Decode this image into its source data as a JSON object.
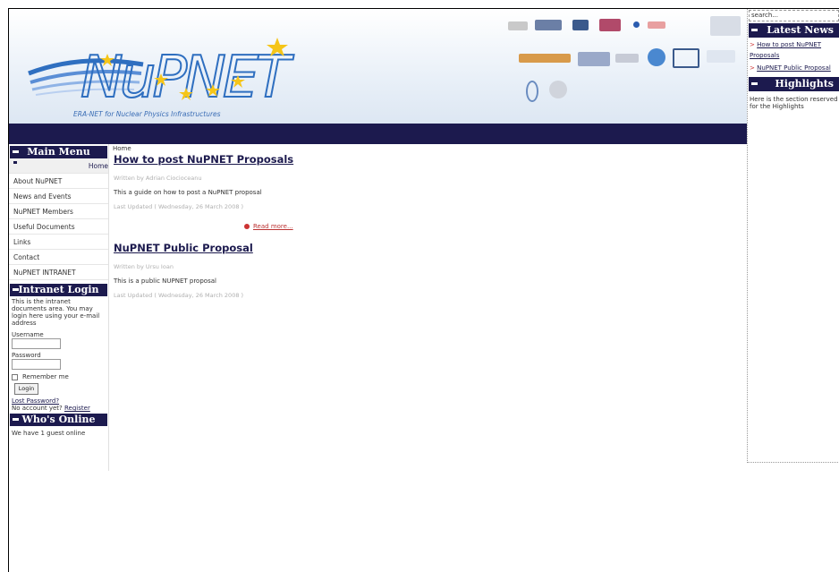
{
  "header": {
    "logo_text": "NuPNET",
    "tagline": "ERA-NET for Nuclear Physics Infrastructures"
  },
  "main_menu": {
    "title": "Main Menu",
    "items": [
      "Home",
      "About NuPNET",
      "News and Events",
      "NuPNET Members",
      "Useful Documents",
      "Links",
      "Contact",
      "NuPNET INTRANET"
    ]
  },
  "login": {
    "title": "Intranet Login",
    "intro": "This is the intranet documents area. You may login here using your e-mail address",
    "username_label": "Username",
    "password_label": "Password",
    "remember_label": "Remember me",
    "login_button": "Login",
    "lost_password": "Lost Password?",
    "no_account": "No account yet?",
    "register": "Register"
  },
  "online": {
    "title": "Who's Online",
    "text": "We have 1 guest online"
  },
  "breadcrumb": "Home",
  "articles": [
    {
      "title": "How to post NuPNET Proposals",
      "author": "Written by Adrian Ciocioceanu",
      "body": "This a guide on how to post a NuPNET proposal",
      "updated": "Last Updated ( Wednesday, 26 March 2008 )",
      "read_more": "Read more..."
    },
    {
      "title": "NuPNET Public Proposal",
      "author": "Written by Ursu Ioan",
      "body": "This is a public NUPNET proposal",
      "updated": "Last Updated ( Wednesday, 26 March 2008 )"
    }
  ],
  "right": {
    "search_placeholder": "search...",
    "latest_news_title": "Latest News",
    "news": [
      "How to post NuPNET Proposals",
      "NuPNET Public Proposal"
    ],
    "highlights_title": "Highlights",
    "highlights_text": "Here is the section reserved for the Highlights"
  },
  "colors": {
    "navy": "#1c1a4e",
    "accent_red": "#cc3333",
    "logo_blue": "#2f6fc0",
    "star_yellow": "#f5c518"
  }
}
